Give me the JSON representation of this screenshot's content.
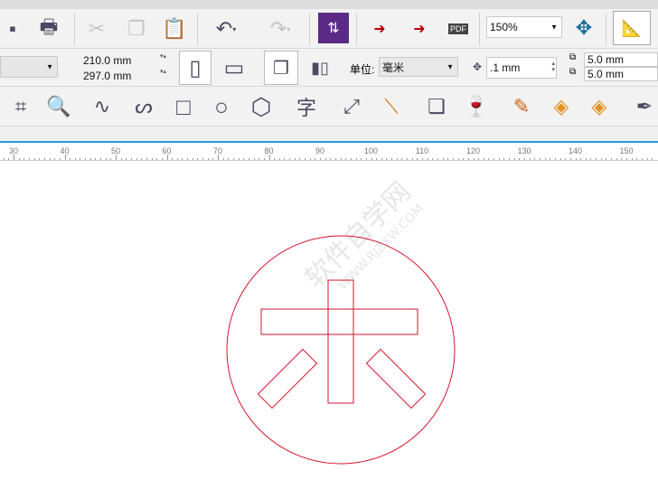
{
  "toolbar1": {
    "zoom_value": "150%",
    "icons": [
      "save-icon",
      "print-icon",
      "cut-icon",
      "copy-icon",
      "paste-icon",
      "undo-icon",
      "redo-icon",
      "launcher-icon",
      "import-icon",
      "export-icon",
      "publish-pdf-icon",
      "full-screen-icon",
      "rulers-icon"
    ],
    "pdf_label": "PDF"
  },
  "toolbar2": {
    "width": "210.0 mm",
    "height": "297.0 mm",
    "units_label": "单位:",
    "units_value": "毫米",
    "nudge": ".1 mm",
    "dup_x": "5.0 mm",
    "dup_y": "5.0 mm"
  },
  "toolbox": {
    "text_tool": "字",
    "icons": [
      "crop-icon",
      "zoom-icon",
      "freehand-icon",
      "artistic-media-icon",
      "rectangle-icon",
      "ellipse-icon",
      "polygon-icon",
      "text-icon",
      "dimension-icon",
      "connector-icon",
      "drop-shadow-icon",
      "transparency-icon",
      "eyedropper-icon",
      "fill-icon",
      "smart-fill-icon",
      "outline-pen-icon"
    ]
  },
  "ruler": {
    "labels": [
      "30",
      "40",
      "50",
      "60",
      "70",
      "80",
      "90",
      "100",
      "110",
      "120",
      "130",
      "140",
      "150"
    ]
  },
  "watermark": {
    "text": "软件自学网",
    "url": "WWW.RJZXW.COM"
  },
  "colors": {
    "stroke": "#d4142c",
    "accent": "#2a9bd8"
  }
}
